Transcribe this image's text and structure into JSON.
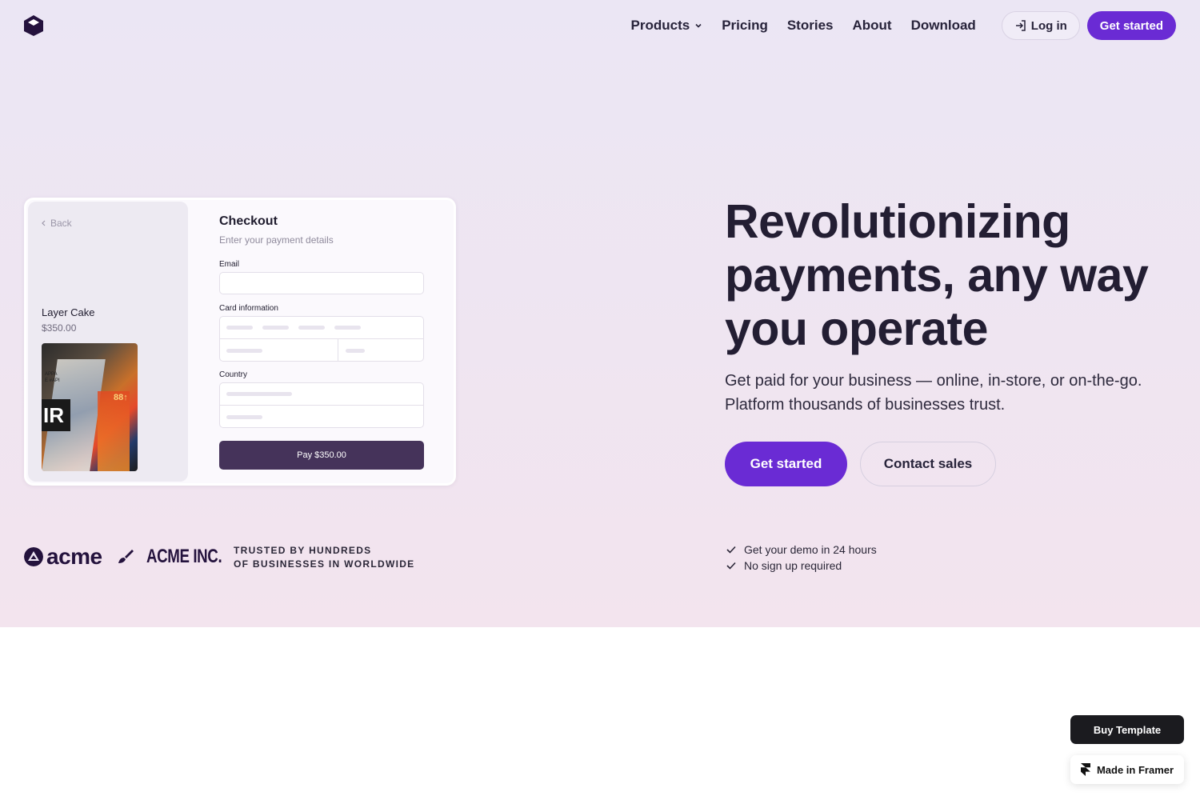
{
  "nav": {
    "links": [
      "Products",
      "Pricing",
      "Stories",
      "About",
      "Download"
    ],
    "login_label": "Log in",
    "get_started_label": "Get started"
  },
  "checkout": {
    "back_label": "Back",
    "product_name": "Layer Cake",
    "product_price": "$350.00",
    "title": "Checkout",
    "subtitle": "Enter your payment details",
    "email_label": "Email",
    "card_label": "Card information",
    "country_label": "Country",
    "pay_label": "Pay $350.00",
    "image_text": {
      "line1": "APPA",
      "line2": "E #API",
      "big": "IR",
      "tag": "88↑"
    }
  },
  "hero": {
    "headline": "Revolutionizing payments, any way you operate",
    "subline": "Get paid for your business — online, in-store, or  on-the-go. Platform thousands of businesses trust.",
    "cta_primary": "Get started",
    "cta_secondary": "Contact sales"
  },
  "trust": {
    "logo1": "acme",
    "logo2": "ACME INC.",
    "text_line1": "TRUSTED BY HUNDREDS",
    "text_line2": "OF BUSINESSES IN WORLDWIDE",
    "checks": [
      "Get your demo in 24 hours",
      "No sign up required"
    ]
  },
  "floating": {
    "buy_label": "Buy Template",
    "framer_label": "Made in Framer"
  },
  "colors": {
    "accent": "#6a2bd4",
    "pay_button": "#45335a",
    "heading": "#231e33"
  },
  "icons": [
    "logo-cube-icon",
    "chevron-down-icon",
    "login-arrow-icon",
    "chevron-left-icon",
    "acme-mark-icon",
    "brush-icon",
    "check-icon",
    "framer-icon"
  ]
}
